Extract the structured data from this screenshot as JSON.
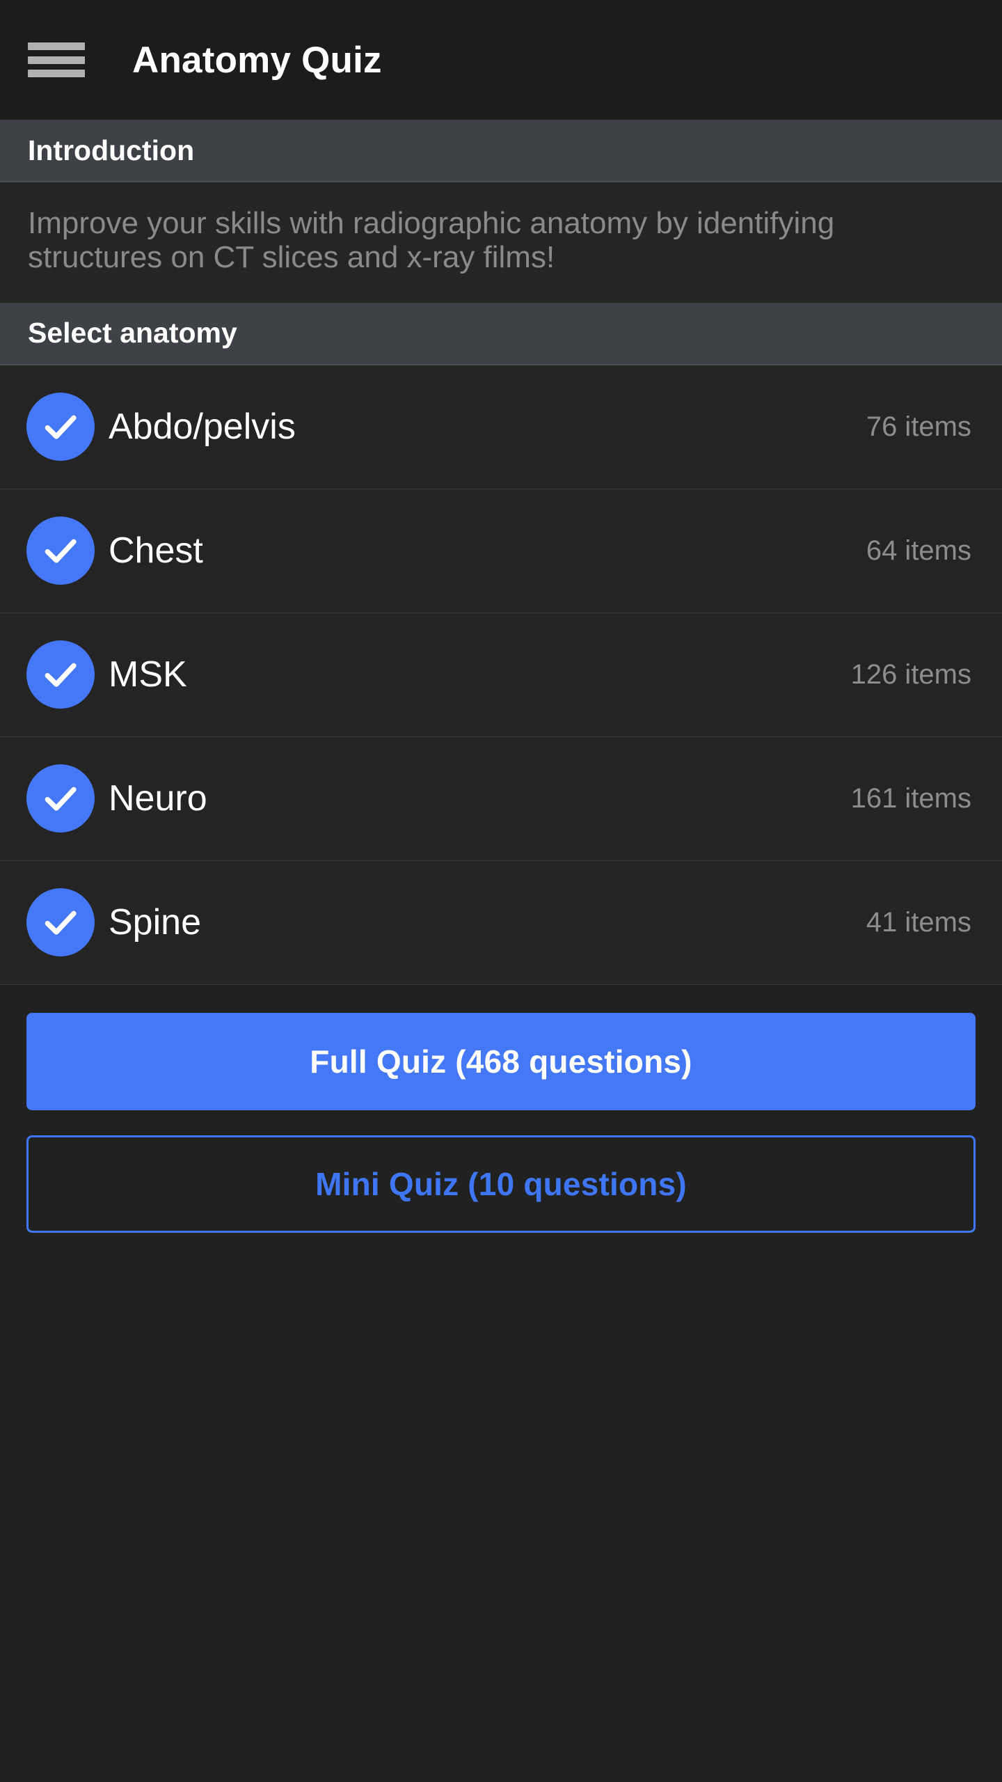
{
  "app": {
    "title": "Anatomy Quiz",
    "menu_icon": "hamburger-menu-icon"
  },
  "intro": {
    "header": "Introduction",
    "body": "Improve your skills with radiographic anatomy by identifying structures on CT slices and x-ray films!"
  },
  "select_anatomy": {
    "header": "Select anatomy",
    "items": [
      {
        "label": "Abdo/pelvis",
        "count": "76 items",
        "checked": true
      },
      {
        "label": "Chest",
        "count": "64 items",
        "checked": true
      },
      {
        "label": "MSK",
        "count": "126 items",
        "checked": true
      },
      {
        "label": "Neuro",
        "count": "161 items",
        "checked": true
      },
      {
        "label": "Spine",
        "count": "41 items",
        "checked": true
      }
    ]
  },
  "actions": {
    "full_quiz": "Full Quiz (468 questions)",
    "mini_quiz": "Mini Quiz (10 questions)"
  },
  "colors": {
    "accent": "#4478f6",
    "background": "#212121",
    "section_header_bg": "#3e4145",
    "appbar_bg": "#1c1c1c",
    "muted_text": "#8a8a8a"
  }
}
